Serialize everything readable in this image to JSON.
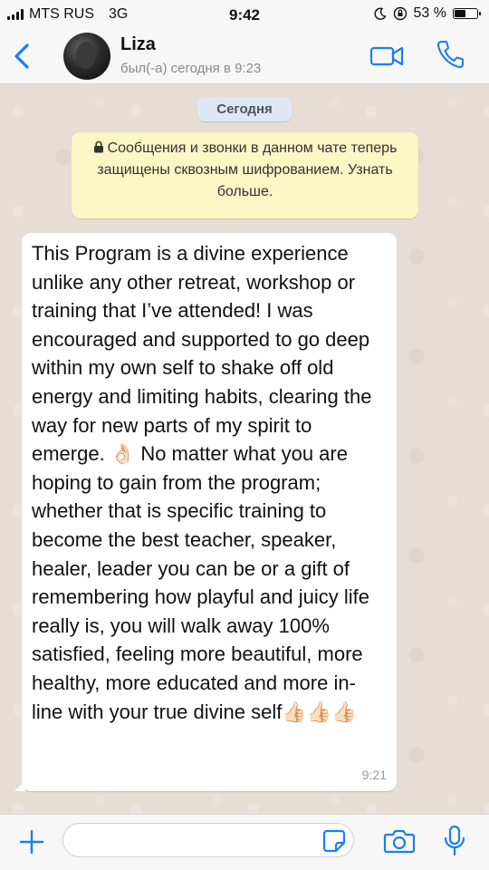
{
  "status_bar": {
    "carrier": "MTS RUS",
    "network": "3G",
    "time": "9:42",
    "battery": "53 %",
    "battery_level": 0.53
  },
  "header": {
    "contact_name": "Liza",
    "last_seen": "был(-а) сегодня в 9:23",
    "icons": [
      "back-chevron-icon",
      "video-camera-icon",
      "phone-icon"
    ]
  },
  "chat": {
    "date_label": "Сегодня",
    "encryption_notice": {
      "text": "Сообщения и звонки в данном чате теперь защищены сквозным шифрованием.",
      "link": "Узнать больше."
    },
    "messages": [
      {
        "text": "This Program is a divine experience unlike any other retreat, workshop or training that I’ve attended! I was encouraged and supported to go deep within my own self to shake off old energy and limiting habits, clearing the way for new parts of my spirit to emerge. 👌🏻 No matter what you are hoping to gain from the program; whether that is specific training to become the best teacher, speaker, healer, leader you can be or a gift of remembering how playful and juicy life really is, you will walk away 100% satisfied, feeling more beautiful, more healthy, more educated and more in-line with your true divine self👍🏻👍🏻👍🏻",
        "time": "9:21"
      }
    ]
  },
  "input_bar": {
    "placeholder": "",
    "icons": [
      "plus-icon",
      "sticker-icon",
      "camera-icon",
      "microphone-icon"
    ]
  },
  "colors": {
    "accent": "#1a7ef5",
    "chat_background": "#e6ddd4",
    "notice_background": "#fcf5c4",
    "date_pill": "#dce8f4"
  }
}
